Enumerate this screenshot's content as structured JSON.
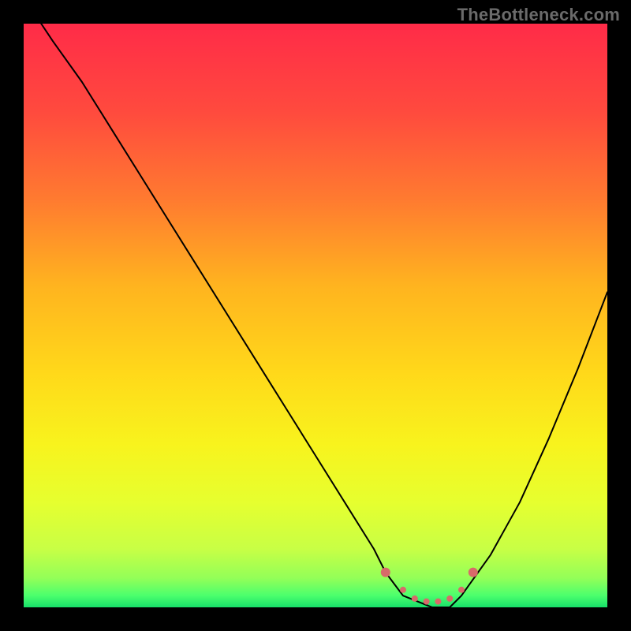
{
  "watermark": "TheBottleneck.com",
  "colors": {
    "curve": "#000000",
    "marker": "#d86a6a",
    "frame": "#000000"
  },
  "gradient_stops": [
    {
      "offset": 0.0,
      "color": "#ff2b48"
    },
    {
      "offset": 0.15,
      "color": "#ff4a3e"
    },
    {
      "offset": 0.3,
      "color": "#ff7a30"
    },
    {
      "offset": 0.45,
      "color": "#ffb41f"
    },
    {
      "offset": 0.6,
      "color": "#ffd91a"
    },
    {
      "offset": 0.72,
      "color": "#f8f31d"
    },
    {
      "offset": 0.82,
      "color": "#e6ff2f"
    },
    {
      "offset": 0.9,
      "color": "#c8ff45"
    },
    {
      "offset": 0.95,
      "color": "#93ff58"
    },
    {
      "offset": 0.98,
      "color": "#4bff6d"
    },
    {
      "offset": 1.0,
      "color": "#17e06a"
    }
  ],
  "chart_data": {
    "type": "line",
    "title": "",
    "xlabel": "",
    "ylabel": "",
    "xlim": [
      0,
      100
    ],
    "ylim": [
      0,
      100
    ],
    "grid": false,
    "legend": false,
    "x": [
      3,
      5,
      10,
      15,
      20,
      25,
      30,
      35,
      40,
      45,
      50,
      55,
      60,
      62,
      65,
      70,
      73,
      75,
      80,
      85,
      90,
      95,
      100
    ],
    "values": [
      100,
      97,
      90,
      82,
      74,
      66,
      58,
      50,
      42,
      34,
      26,
      18,
      10,
      6,
      2,
      0,
      0,
      2,
      9,
      18,
      29,
      41,
      54
    ],
    "markers": [
      {
        "x": 62,
        "y": 6
      },
      {
        "x": 65,
        "y": 3
      },
      {
        "x": 67,
        "y": 1.5
      },
      {
        "x": 69,
        "y": 1
      },
      {
        "x": 71,
        "y": 1
      },
      {
        "x": 73,
        "y": 1.5
      },
      {
        "x": 75,
        "y": 3
      },
      {
        "x": 77,
        "y": 6
      }
    ]
  }
}
